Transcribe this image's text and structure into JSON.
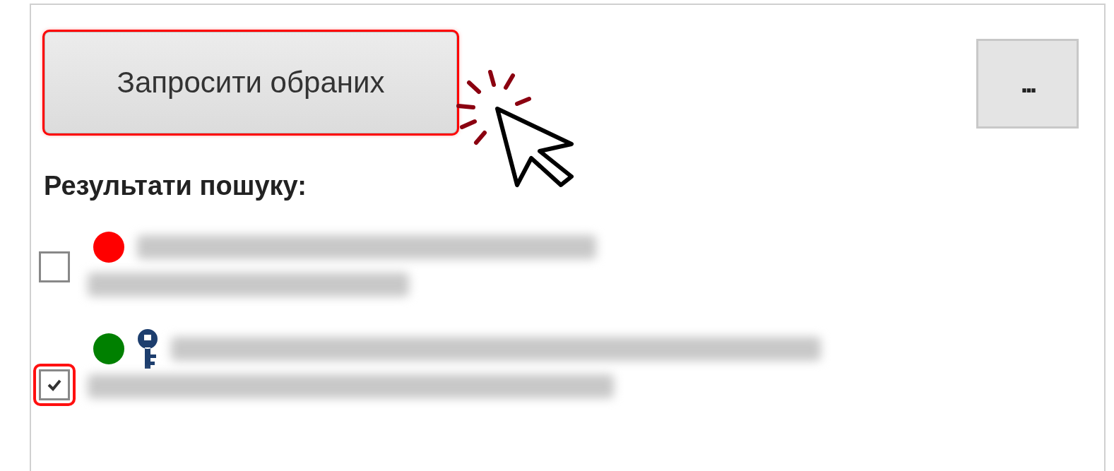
{
  "request_button": {
    "label": "Запросити обраних",
    "highlighted": true
  },
  "more_button": {
    "label": "..."
  },
  "results_heading": "Результати пошуку:",
  "results": [
    {
      "selected": false,
      "highlighted": false,
      "color": "#ff0000",
      "has_key": false
    },
    {
      "selected": true,
      "highlighted": true,
      "color": "#008000",
      "has_key": true
    }
  ]
}
